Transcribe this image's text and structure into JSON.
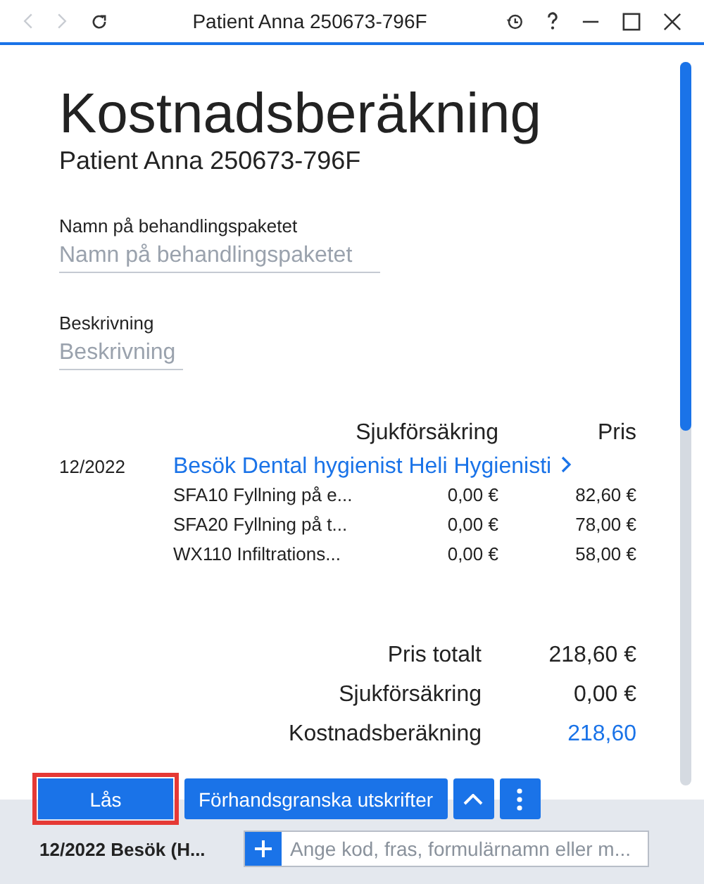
{
  "window": {
    "title": "Patient Anna 250673-796F",
    "back_disabled": true,
    "forward_disabled": true
  },
  "header": {
    "title": "Kostnadsberäkning",
    "subtitle": "Patient Anna 250673-796F"
  },
  "fields": [
    {
      "label": "Namn på behandlingspaketet",
      "placeholder": "Namn på behandlingspaketet"
    },
    {
      "label": "Beskrivning",
      "placeholder": "Beskrivning"
    }
  ],
  "table": {
    "columns": [
      "Sjukförsäkring",
      "Pris"
    ],
    "visits": [
      {
        "date": "12/2022",
        "title": "Besök Dental hygienist Heli Hygienisti",
        "rows": [
          {
            "name": "SFA10 Fyllning på e...",
            "insurance": "0,00 €",
            "price": "82,60 €"
          },
          {
            "name": "SFA20 Fyllning på t...",
            "insurance": "0,00 €",
            "price": "78,00 €"
          },
          {
            "name": "WX110 Infiltrations...",
            "insurance": "0,00 €",
            "price": "58,00 €"
          }
        ]
      }
    ]
  },
  "totals": [
    {
      "label": "Pris totalt",
      "value": "218,60 €",
      "kind": "plain"
    },
    {
      "label": "Sjukförsäkring",
      "value": "0,00 €",
      "kind": "plain"
    },
    {
      "label": "Kostnadsberäkning",
      "value": "218,60",
      "kind": "link"
    }
  ],
  "actions": {
    "lock": {
      "label": "Lås",
      "highlighted": true
    },
    "preview": {
      "label": "Förhandsgranska utskrifter"
    }
  },
  "footer": {
    "visit": "12/2022 Besök (H...",
    "search": {
      "placeholder": "Ange kod, fras, formulärnamn eller m..."
    }
  }
}
